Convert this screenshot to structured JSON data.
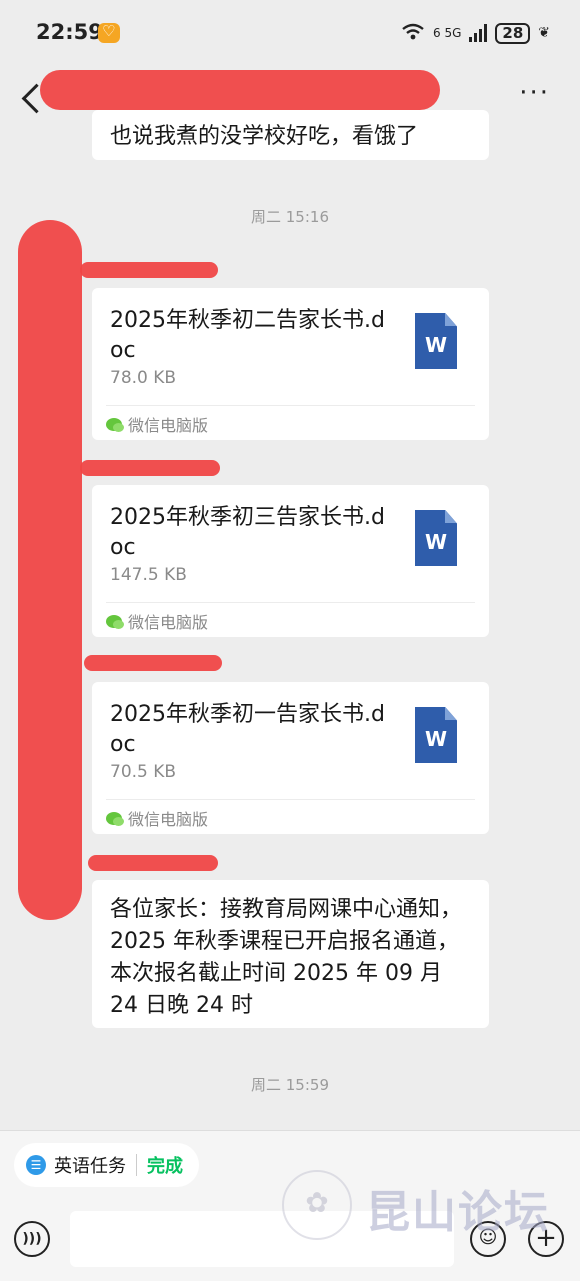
{
  "status_bar": {
    "time": "22:59",
    "signal_labels": "6 5G",
    "battery": "28"
  },
  "chat": {
    "partial_message": "也说我煮的没学校好吃，看饿了",
    "timestamps": [
      "周二 15:16",
      "周二 15:59"
    ],
    "files": [
      {
        "name": "2025年秋季初二告家长书.doc",
        "size": "78.0 KB",
        "source": "微信电脑版",
        "icon": "word-doc-icon"
      },
      {
        "name": "2025年秋季初三告家长书.doc",
        "size": "147.5 KB",
        "source": "微信电脑版",
        "icon": "word-doc-icon"
      },
      {
        "name": "2025年秋季初一告家长书.doc",
        "size": "70.5 KB",
        "source": "微信电脑版",
        "icon": "word-doc-icon"
      }
    ],
    "text_message": "各位家长：接教育局网课中心通知，2025 年秋季课程已开启报名通道，本次报名截止时间 2025 年 09 月 24 日晚 24 时"
  },
  "bottom": {
    "task_label": "英语任务",
    "task_status": "完成",
    "input_value": "",
    "watermark": "昆山论坛"
  },
  "icons": {
    "word_letter": "W",
    "emoji": "☺",
    "plus": "+",
    "voice": ")))",
    "more": "···"
  },
  "colors": {
    "background": "#ededed",
    "accent_green": "#07c160",
    "word_blue": "#2f5dab",
    "redaction": "#f04545"
  }
}
